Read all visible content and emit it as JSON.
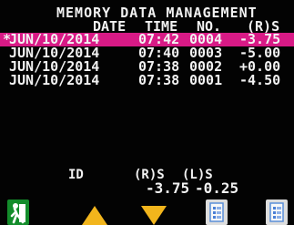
{
  "screen": {
    "title": "MEMORY DATA MANAGEMENT"
  },
  "table": {
    "headers": {
      "date": "DATE",
      "time": "TIME",
      "no": "NO.",
      "value": "(R)S"
    },
    "rows": [
      {
        "marker": "*",
        "date": "JUN/10/2014",
        "time": "07:42",
        "no": "0004",
        "value": "-3.75",
        "selected": true
      },
      {
        "marker": "",
        "date": "JUN/10/2014",
        "time": "07:40",
        "no": "0003",
        "value": "-5.00",
        "selected": false
      },
      {
        "marker": "",
        "date": "JUN/10/2014",
        "time": "07:38",
        "no": "0002",
        "value": "+0.00",
        "selected": false
      },
      {
        "marker": "",
        "date": "JUN/10/2014",
        "time": "07:38",
        "no": "0001",
        "value": "-4.50",
        "selected": false
      }
    ]
  },
  "footer": {
    "labels": {
      "id": "ID",
      "right": "(R)S",
      "left": "(L)S"
    },
    "values": {
      "right": "-3.75",
      "left": "-0.25"
    }
  },
  "softkeys": {
    "exit": "exit-icon",
    "up": "arrow-up-icon",
    "down": "arrow-down-icon",
    "document_a": "document-list-icon",
    "document_b": "document-list-icon"
  },
  "colors": {
    "background": "#030303",
    "text": "#f2f2f2",
    "selected_row": "#d81a86",
    "exit": "#138c2b",
    "arrow": "#f2b51c",
    "document": "#dddddd"
  }
}
